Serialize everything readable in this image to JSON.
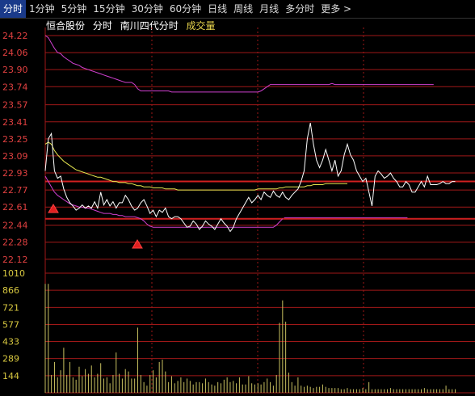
{
  "toolbar": {
    "tabs": [
      {
        "label": "分时",
        "active": true
      },
      {
        "label": "1分钟",
        "active": false
      },
      {
        "label": "5分钟",
        "active": false
      },
      {
        "label": "15分钟",
        "active": false
      },
      {
        "label": "30分钟",
        "active": false
      },
      {
        "label": "60分钟",
        "active": false
      },
      {
        "label": "日线",
        "active": false
      },
      {
        "label": "周线",
        "active": false
      },
      {
        "label": "月线",
        "active": false
      },
      {
        "label": "多分时",
        "active": false
      },
      {
        "label": "更多 >",
        "active": false
      }
    ]
  },
  "legend": {
    "stock_name": "恒合股份",
    "mode": "分时",
    "compare": "南川四代分时",
    "volume": "成交量"
  },
  "colors": {
    "price_line": "#ffffff",
    "avg_line": "#e8e850",
    "compare_line": "#d040d0",
    "volume_bar": "#c8c060",
    "grid": "#a01818",
    "axis_label": "#e04040",
    "volume_label": "#d8c840"
  },
  "chart_data": {
    "type": "line",
    "price_ticks": [
      "24.22",
      "24.06",
      "23.90",
      "23.74",
      "23.57",
      "23.41",
      "23.25",
      "23.09",
      "22.93",
      "22.77",
      "22.61",
      "22.44",
      "22.28",
      "22.12"
    ],
    "volume_ticks": [
      "1010",
      "866",
      "721",
      "577",
      "433",
      "289",
      "144"
    ],
    "price_range": [
      22.05,
      24.22
    ],
    "volume_range": [
      0,
      1010
    ],
    "price": [
      22.95,
      23.25,
      23.3,
      22.95,
      22.88,
      22.9,
      22.78,
      22.7,
      22.65,
      22.62,
      22.58,
      22.6,
      22.63,
      22.6,
      22.62,
      22.6,
      22.66,
      22.6,
      22.75,
      22.63,
      22.68,
      22.62,
      22.66,
      22.6,
      22.65,
      22.65,
      22.72,
      22.68,
      22.62,
      22.58,
      22.6,
      22.65,
      22.68,
      22.62,
      22.55,
      22.58,
      22.52,
      22.58,
      22.56,
      22.6,
      22.52,
      22.5,
      22.52,
      22.52,
      22.5,
      22.46,
      22.42,
      22.43,
      22.48,
      22.45,
      22.4,
      22.43,
      22.48,
      22.45,
      22.43,
      22.4,
      22.45,
      22.5,
      22.46,
      22.43,
      22.38,
      22.42,
      22.5,
      22.55,
      22.6,
      22.65,
      22.7,
      22.65,
      22.68,
      22.72,
      22.68,
      22.75,
      22.72,
      22.7,
      22.76,
      22.72,
      22.7,
      22.75,
      22.7,
      22.68,
      22.72,
      22.75,
      22.78,
      22.85,
      22.95,
      23.25,
      23.4,
      23.2,
      23.05,
      22.98,
      23.05,
      23.15,
      23.05,
      22.95,
      23.05,
      22.9,
      22.95,
      23.1,
      23.2,
      23.1,
      23.05,
      22.95,
      22.9,
      22.85,
      22.88,
      22.75,
      22.62,
      22.9,
      22.95,
      22.92,
      22.88,
      22.9,
      22.93,
      22.88,
      22.85,
      22.8,
      22.8,
      22.85,
      22.82,
      22.75,
      22.75,
      22.8,
      22.85,
      22.8,
      22.9,
      22.82,
      22.82,
      22.82,
      22.83,
      22.85,
      22.83,
      22.83,
      22.85,
      22.85
    ],
    "avg": [
      23.2,
      23.22,
      23.2,
      23.14,
      23.1,
      23.07,
      23.04,
      23.02,
      23.0,
      22.98,
      22.96,
      22.95,
      22.94,
      22.93,
      22.92,
      22.91,
      22.9,
      22.89,
      22.89,
      22.88,
      22.87,
      22.86,
      22.85,
      22.85,
      22.84,
      22.84,
      22.84,
      22.83,
      22.83,
      22.82,
      22.81,
      22.81,
      22.8,
      22.8,
      22.8,
      22.79,
      22.79,
      22.79,
      22.79,
      22.78,
      22.78,
      22.78,
      22.78,
      22.77,
      22.77,
      22.77,
      22.77,
      22.77,
      22.77,
      22.77,
      22.77,
      22.77,
      22.77,
      22.77,
      22.77,
      22.77,
      22.77,
      22.77,
      22.77,
      22.77,
      22.77,
      22.77,
      22.77,
      22.77,
      22.77,
      22.77,
      22.77,
      22.77,
      22.77,
      22.78,
      22.78,
      22.78,
      22.78,
      22.78,
      22.78,
      22.78,
      22.79,
      22.79,
      22.8,
      22.8,
      22.8,
      22.8,
      22.8,
      22.8,
      22.8,
      22.81,
      22.81,
      22.82,
      22.82,
      22.82,
      22.82,
      22.83,
      22.83,
      22.83,
      22.83,
      22.83,
      22.83,
      22.83,
      22.83
    ],
    "compare": [
      24.22,
      24.2,
      24.15,
      24.1,
      24.06,
      24.05,
      24.02,
      24.0,
      23.98,
      23.96,
      23.95,
      23.94,
      23.92,
      23.91,
      23.9,
      23.89,
      23.88,
      23.87,
      23.86,
      23.85,
      23.84,
      23.83,
      23.82,
      23.81,
      23.8,
      23.79,
      23.78,
      23.78,
      23.78,
      23.76,
      23.72,
      23.7,
      23.7,
      23.7,
      23.7,
      23.7,
      23.7,
      23.7,
      23.7,
      23.7,
      23.7,
      23.69,
      23.69,
      23.69,
      23.69,
      23.69,
      23.69,
      23.69,
      23.69,
      23.69,
      23.69,
      23.69,
      23.69,
      23.69,
      23.69,
      23.69,
      23.69,
      23.69,
      23.69,
      23.69,
      23.69,
      23.69,
      23.69,
      23.69,
      23.69,
      23.69,
      23.69,
      23.69,
      23.69,
      23.69,
      23.7,
      23.72,
      23.74,
      23.76,
      23.76,
      23.76,
      23.76,
      23.76,
      23.76,
      23.76,
      23.76,
      23.76,
      23.76,
      23.76,
      23.76,
      23.76,
      23.76,
      23.76,
      23.76,
      23.76,
      23.76,
      23.76,
      23.76,
      23.77,
      23.76,
      23.76,
      23.76,
      23.76,
      23.76,
      23.76,
      23.76,
      23.76,
      23.76,
      23.76,
      23.76,
      23.76,
      23.76,
      23.76,
      23.76,
      23.76,
      23.76,
      23.76,
      23.76,
      23.76,
      23.76,
      23.76,
      23.76,
      23.76,
      23.76,
      23.76,
      23.76,
      23.76,
      23.76,
      23.76,
      23.76,
      23.76,
      23.76
    ],
    "compare_low": [
      22.9,
      22.85,
      22.8,
      22.75,
      22.72,
      22.7,
      22.68,
      22.66,
      22.64,
      22.63,
      22.62,
      22.61,
      22.61,
      22.6,
      22.6,
      22.59,
      22.58,
      22.57,
      22.56,
      22.55,
      22.55,
      22.55,
      22.54,
      22.54,
      22.53,
      22.53,
      22.52,
      22.52,
      22.52,
      22.52,
      22.51,
      22.5,
      22.48,
      22.45,
      22.43,
      22.42,
      22.42,
      22.42,
      22.42,
      22.42,
      22.42,
      22.42,
      22.42,
      22.42,
      22.42,
      22.42,
      22.42,
      22.42,
      22.42,
      22.42,
      22.42,
      22.42,
      22.42,
      22.42,
      22.42,
      22.42,
      22.42,
      22.42,
      22.42,
      22.42,
      22.42,
      22.42,
      22.42,
      22.42,
      22.42,
      22.42,
      22.42,
      22.42,
      22.42,
      22.42,
      22.42,
      22.42,
      22.42,
      22.42,
      22.42,
      22.44,
      22.47,
      22.5
    ],
    "compare_low_tail": [
      22.51,
      22.51,
      22.51,
      22.51,
      22.51,
      22.51,
      22.51,
      22.51,
      22.51,
      22.51,
      22.51,
      22.51,
      22.51,
      22.51,
      22.51,
      22.51,
      22.51,
      22.51,
      22.51,
      22.51,
      22.51,
      22.51,
      22.51,
      22.51,
      22.51,
      22.51,
      22.51,
      22.51,
      22.51,
      22.51,
      22.51,
      22.51,
      22.51,
      22.51,
      22.51,
      22.51,
      22.51,
      22.51,
      22.51,
      22.51,
      22.51
    ],
    "volume": [
      920,
      920,
      150,
      260,
      130,
      190,
      380,
      150,
      260,
      130,
      110,
      220,
      140,
      200,
      160,
      230,
      130,
      160,
      250,
      120,
      130,
      80,
      150,
      340,
      160,
      120,
      200,
      180,
      120,
      120,
      550,
      150,
      90,
      60,
      150,
      190,
      130,
      260,
      280,
      180,
      90,
      140,
      80,
      100,
      130,
      90,
      120,
      100,
      70,
      90,
      90,
      80,
      120,
      90,
      70,
      60,
      90,
      80,
      110,
      130,
      90,
      100,
      80,
      130,
      70,
      70,
      140,
      80,
      70,
      80,
      70,
      90,
      120,
      90,
      60,
      150,
      590,
      780,
      600,
      170,
      90,
      60,
      130,
      60,
      50,
      60,
      50,
      40,
      50,
      50,
      70,
      50,
      40,
      40,
      40,
      40,
      30,
      30,
      40,
      30,
      30,
      30,
      30,
      40,
      30,
      90,
      30,
      30,
      30,
      30,
      30,
      30,
      40,
      30,
      30,
      30,
      30,
      30,
      30,
      30,
      30,
      30,
      30,
      40,
      30,
      30,
      30,
      30,
      30,
      30,
      60,
      30,
      30,
      30
    ],
    "base_line_price": 22.85,
    "low_line_price": 22.5
  }
}
